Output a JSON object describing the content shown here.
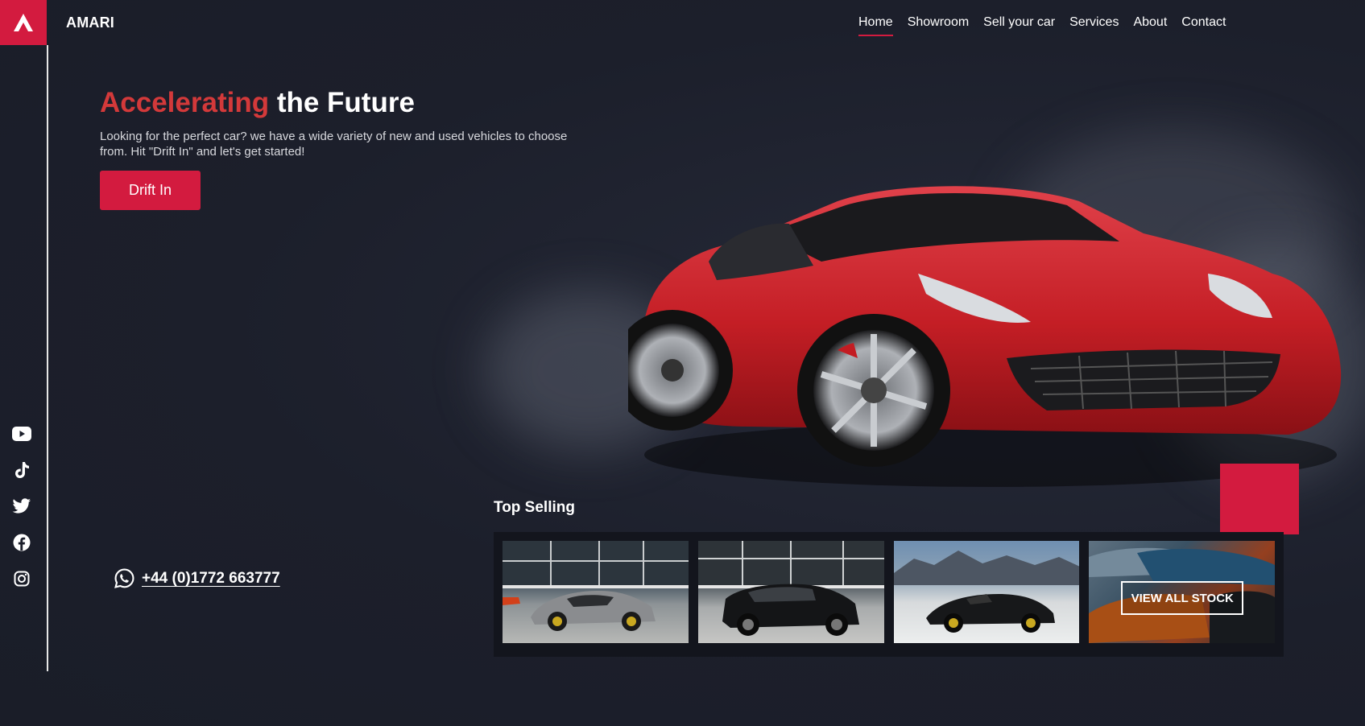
{
  "brand": {
    "name": "AMARI",
    "logo_icon": "amari-a-logo-icon"
  },
  "nav": {
    "items": [
      {
        "label": "Home",
        "active": true
      },
      {
        "label": "Showroom",
        "active": false
      },
      {
        "label": "Sell your car",
        "active": false
      },
      {
        "label": "Services",
        "active": false
      },
      {
        "label": "About",
        "active": false
      },
      {
        "label": "Contact",
        "active": false
      }
    ]
  },
  "hero": {
    "title_accent": "Accelerating",
    "title_rest": "the Future",
    "description": "Looking for the perfect car? we have a wide variety of new and used vehicles to choose from. Hit \"Drift In\" and let's get started!",
    "cta_label": "Drift In"
  },
  "contact": {
    "phone": "+44 (0)1772 663777",
    "icon": "whatsapp-icon"
  },
  "socials": [
    "youtube-icon",
    "tiktok-icon",
    "twitter-icon",
    "facebook-icon",
    "instagram-icon"
  ],
  "top_selling": {
    "title": "Top Selling",
    "cars": [
      {
        "color": "silver"
      },
      {
        "color": "black"
      },
      {
        "color": "black"
      }
    ],
    "view_all_label": "VIEW ALL STOCK"
  },
  "colors": {
    "accent": "#d31b3f",
    "title_accent": "#d3393a",
    "background": "#1c1f2b"
  }
}
